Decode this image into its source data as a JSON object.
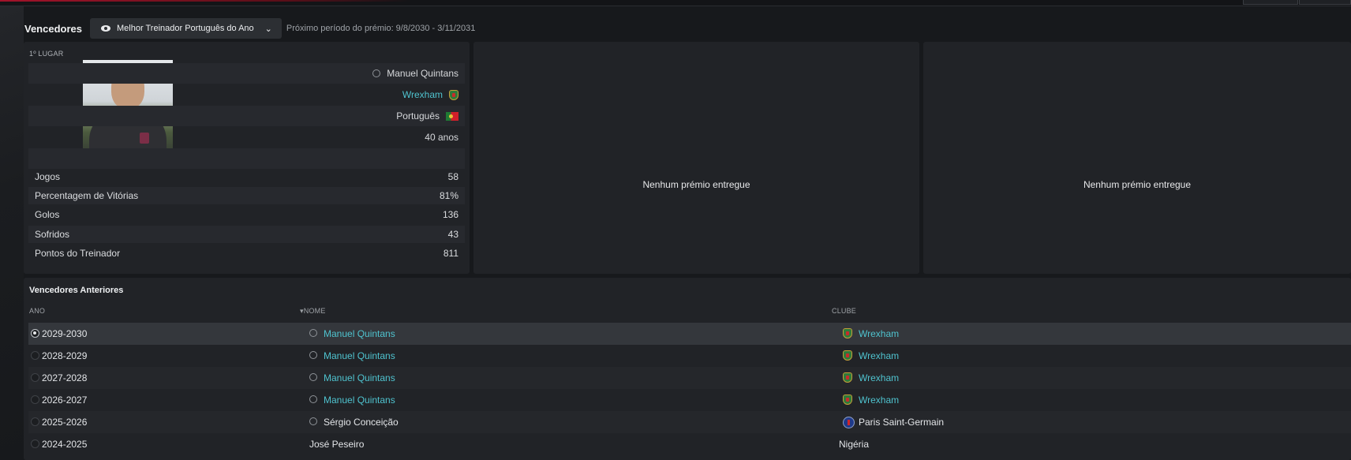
{
  "header": {
    "title": "Vencedores",
    "award_select": "Melhor Treinador Português do Ano",
    "next_period": "Próximo período do prémio: 9/8/2030 - 3/11/2031"
  },
  "winner": {
    "place_label": "1º LUGAR",
    "name": "Manuel Quintans",
    "club": "Wrexham",
    "nationality": "Português",
    "age": "40 anos",
    "stats": [
      {
        "label": "Jogos",
        "value": "58"
      },
      {
        "label": "Percentagem de Vitórias",
        "value": "81%"
      },
      {
        "label": "Golos",
        "value": "136"
      },
      {
        "label": "Sofridos",
        "value": "43"
      },
      {
        "label": "Pontos do Treinador",
        "value": "811"
      }
    ]
  },
  "empty_panels": [
    "Nenhum prémio entregue",
    "Nenhum prémio entregue"
  ],
  "previous": {
    "title": "Vencedores Anteriores",
    "columns": {
      "year": "ANO",
      "name": "NOME",
      "club": "CLUBE"
    },
    "sort_icon": "sort-desc-icon",
    "rows": [
      {
        "year": "2029-2030",
        "name": "Manuel Quintans",
        "club": "Wrexham"
      },
      {
        "year": "2028-2029",
        "name": "Manuel Quintans",
        "club": "Wrexham"
      },
      {
        "year": "2027-2028",
        "name": "Manuel Quintans",
        "club": "Wrexham"
      },
      {
        "year": "2026-2027",
        "name": "Manuel Quintans",
        "club": "Wrexham"
      },
      {
        "year": "2025-2026",
        "name": "Sérgio Conceição",
        "club": "Paris Saint-Germain"
      },
      {
        "year": "2024-2025",
        "name": "José Peseiro",
        "club": "Nigéria"
      }
    ]
  },
  "colors": {
    "link": "#4fc3cf",
    "accent_red": "#a3132a",
    "panel": "#212327"
  }
}
